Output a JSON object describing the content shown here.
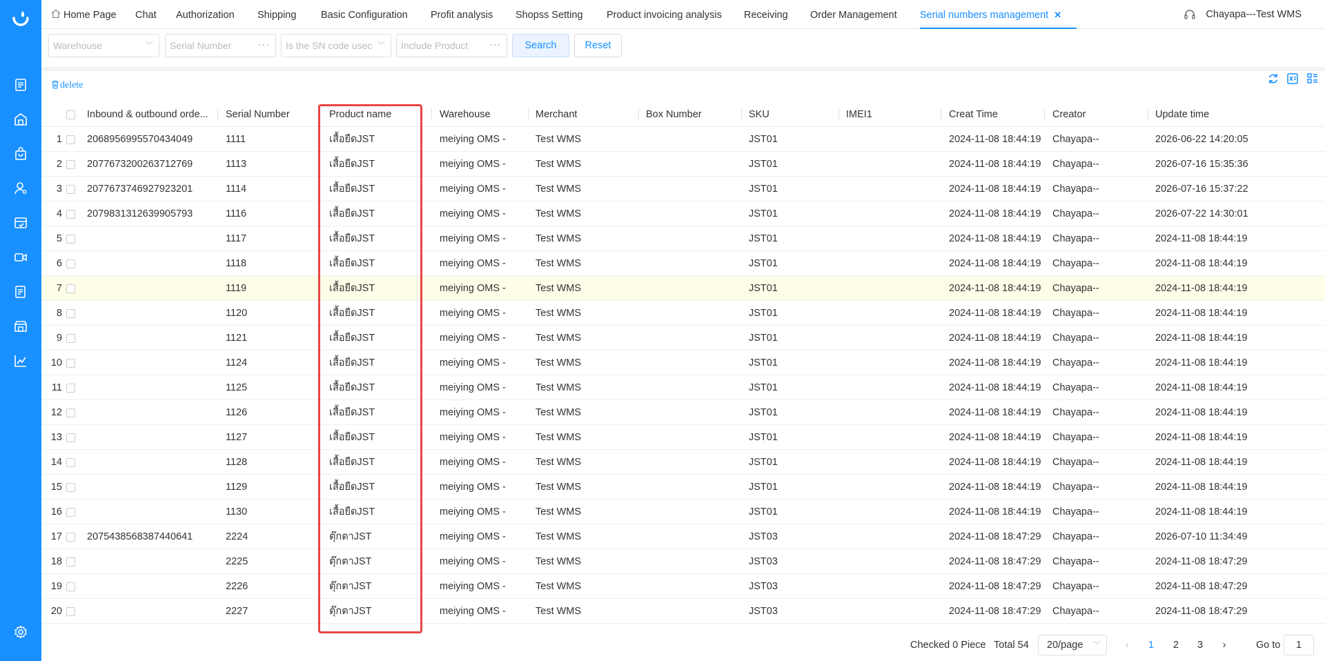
{
  "tabs": [
    {
      "label": "Home Page",
      "home": true
    },
    {
      "label": "Chat"
    },
    {
      "label": "Authorization"
    },
    {
      "label": "Shipping"
    },
    {
      "label": "Basic Configuration"
    },
    {
      "label": "Profit analysis"
    },
    {
      "label": "Shopss Setting"
    },
    {
      "label": "Product invoicing analysis"
    },
    {
      "label": "Receiving"
    },
    {
      "label": "Order Management"
    },
    {
      "label": "Serial numbers management",
      "active": true
    }
  ],
  "user": "Chayapa---Test WMS",
  "filters": {
    "warehouse_placeholder": "Warehouse",
    "serial_placeholder": "Serial Number",
    "sn_used_placeholder": "Is the SN code usec",
    "include_product_placeholder": "Include Product",
    "search_label": "Search",
    "reset_label": "Reset"
  },
  "toolbar": {
    "delete_label": "delete"
  },
  "table": {
    "columns": [
      "Inbound & outbound orde...",
      "Serial Number",
      "Product name",
      "Warehouse",
      "Merchant",
      "Box Number",
      "SKU",
      "IMEI1",
      "Creat Time",
      "Creator",
      "Update time"
    ],
    "rows": [
      {
        "idx": "1",
        "order": "2068956995570434049",
        "serial": "1111",
        "product": "เสื้อยืดJST",
        "warehouse": "meiying OMS -",
        "merchant": "Test WMS",
        "box": "",
        "sku": "JST01",
        "imei": "",
        "created": "2024-11-08 18:44:19",
        "creator": "Chayapa--",
        "updated": "2026-06-22 14:20:05"
      },
      {
        "idx": "2",
        "order": "2077673200263712769",
        "serial": "1113",
        "product": "เสื้อยืดJST",
        "warehouse": "meiying OMS -",
        "merchant": "Test WMS",
        "box": "",
        "sku": "JST01",
        "imei": "",
        "created": "2024-11-08 18:44:19",
        "creator": "Chayapa--",
        "updated": "2026-07-16 15:35:36"
      },
      {
        "idx": "3",
        "order": "2077673746927923201",
        "serial": "1114",
        "product": "เสื้อยืดJST",
        "warehouse": "meiying OMS -",
        "merchant": "Test WMS",
        "box": "",
        "sku": "JST01",
        "imei": "",
        "created": "2024-11-08 18:44:19",
        "creator": "Chayapa--",
        "updated": "2026-07-16 15:37:22"
      },
      {
        "idx": "4",
        "order": "2079831312639905793",
        "serial": "1116",
        "product": "เสื้อยืดJST",
        "warehouse": "meiying OMS -",
        "merchant": "Test WMS",
        "box": "",
        "sku": "JST01",
        "imei": "",
        "created": "2024-11-08 18:44:19",
        "creator": "Chayapa--",
        "updated": "2026-07-22 14:30:01"
      },
      {
        "idx": "5",
        "order": "",
        "serial": "1117",
        "product": "เสื้อยืดJST",
        "warehouse": "meiying OMS -",
        "merchant": "Test WMS",
        "box": "",
        "sku": "JST01",
        "imei": "",
        "created": "2024-11-08 18:44:19",
        "creator": "Chayapa--",
        "updated": "2024-11-08 18:44:19"
      },
      {
        "idx": "6",
        "order": "",
        "serial": "1118",
        "product": "เสื้อยืดJST",
        "warehouse": "meiying OMS -",
        "merchant": "Test WMS",
        "box": "",
        "sku": "JST01",
        "imei": "",
        "created": "2024-11-08 18:44:19",
        "creator": "Chayapa--",
        "updated": "2024-11-08 18:44:19"
      },
      {
        "idx": "7",
        "order": "",
        "serial": "1119",
        "product": "เสื้อยืดJST",
        "warehouse": "meiying OMS -",
        "merchant": "Test WMS",
        "box": "",
        "sku": "JST01",
        "imei": "",
        "created": "2024-11-08 18:44:19",
        "creator": "Chayapa--",
        "updated": "2024-11-08 18:44:19",
        "highlight": true
      },
      {
        "idx": "8",
        "order": "",
        "serial": "1120",
        "product": "เสื้อยืดJST",
        "warehouse": "meiying OMS -",
        "merchant": "Test WMS",
        "box": "",
        "sku": "JST01",
        "imei": "",
        "created": "2024-11-08 18:44:19",
        "creator": "Chayapa--",
        "updated": "2024-11-08 18:44:19"
      },
      {
        "idx": "9",
        "order": "",
        "serial": "1121",
        "product": "เสื้อยืดJST",
        "warehouse": "meiying OMS -",
        "merchant": "Test WMS",
        "box": "",
        "sku": "JST01",
        "imei": "",
        "created": "2024-11-08 18:44:19",
        "creator": "Chayapa--",
        "updated": "2024-11-08 18:44:19"
      },
      {
        "idx": "10",
        "order": "",
        "serial": "1124",
        "product": "เสื้อยืดJST",
        "warehouse": "meiying OMS -",
        "merchant": "Test WMS",
        "box": "",
        "sku": "JST01",
        "imei": "",
        "created": "2024-11-08 18:44:19",
        "creator": "Chayapa--",
        "updated": "2024-11-08 18:44:19"
      },
      {
        "idx": "11",
        "order": "",
        "serial": "1125",
        "product": "เสื้อยืดJST",
        "warehouse": "meiying OMS -",
        "merchant": "Test WMS",
        "box": "",
        "sku": "JST01",
        "imei": "",
        "created": "2024-11-08 18:44:19",
        "creator": "Chayapa--",
        "updated": "2024-11-08 18:44:19"
      },
      {
        "idx": "12",
        "order": "",
        "serial": "1126",
        "product": "เสื้อยืดJST",
        "warehouse": "meiying OMS -",
        "merchant": "Test WMS",
        "box": "",
        "sku": "JST01",
        "imei": "",
        "created": "2024-11-08 18:44:19",
        "creator": "Chayapa--",
        "updated": "2024-11-08 18:44:19"
      },
      {
        "idx": "13",
        "order": "",
        "serial": "1127",
        "product": "เสื้อยืดJST",
        "warehouse": "meiying OMS -",
        "merchant": "Test WMS",
        "box": "",
        "sku": "JST01",
        "imei": "",
        "created": "2024-11-08 18:44:19",
        "creator": "Chayapa--",
        "updated": "2024-11-08 18:44:19"
      },
      {
        "idx": "14",
        "order": "",
        "serial": "1128",
        "product": "เสื้อยืดJST",
        "warehouse": "meiying OMS -",
        "merchant": "Test WMS",
        "box": "",
        "sku": "JST01",
        "imei": "",
        "created": "2024-11-08 18:44:19",
        "creator": "Chayapa--",
        "updated": "2024-11-08 18:44:19"
      },
      {
        "idx": "15",
        "order": "",
        "serial": "1129",
        "product": "เสื้อยืดJST",
        "warehouse": "meiying OMS -",
        "merchant": "Test WMS",
        "box": "",
        "sku": "JST01",
        "imei": "",
        "created": "2024-11-08 18:44:19",
        "creator": "Chayapa--",
        "updated": "2024-11-08 18:44:19"
      },
      {
        "idx": "16",
        "order": "",
        "serial": "1130",
        "product": "เสื้อยืดJST",
        "warehouse": "meiying OMS -",
        "merchant": "Test WMS",
        "box": "",
        "sku": "JST01",
        "imei": "",
        "created": "2024-11-08 18:44:19",
        "creator": "Chayapa--",
        "updated": "2024-11-08 18:44:19"
      },
      {
        "idx": "17",
        "order": "2075438568387440641",
        "serial": "2224",
        "product": "ตุ๊กตาJST",
        "warehouse": "meiying OMS -",
        "merchant": "Test WMS",
        "box": "",
        "sku": "JST03",
        "imei": "",
        "created": "2024-11-08 18:47:29",
        "creator": "Chayapa--",
        "updated": "2026-07-10 11:34:49"
      },
      {
        "idx": "18",
        "order": "",
        "serial": "2225",
        "product": "ตุ๊กตาJST",
        "warehouse": "meiying OMS -",
        "merchant": "Test WMS",
        "box": "",
        "sku": "JST03",
        "imei": "",
        "created": "2024-11-08 18:47:29",
        "creator": "Chayapa--",
        "updated": "2024-11-08 18:47:29"
      },
      {
        "idx": "19",
        "order": "",
        "serial": "2226",
        "product": "ตุ๊กตาJST",
        "warehouse": "meiying OMS -",
        "merchant": "Test WMS",
        "box": "",
        "sku": "JST03",
        "imei": "",
        "created": "2024-11-08 18:47:29",
        "creator": "Chayapa--",
        "updated": "2024-11-08 18:47:29"
      },
      {
        "idx": "20",
        "order": "",
        "serial": "2227",
        "product": "ตุ๊กตาJST",
        "warehouse": "meiying OMS -",
        "merchant": "Test WMS",
        "box": "",
        "sku": "JST03",
        "imei": "",
        "created": "2024-11-08 18:47:29",
        "creator": "Chayapa--",
        "updated": "2024-11-08 18:47:29"
      }
    ]
  },
  "footer": {
    "checked": "Checked 0 Piece",
    "total": "Total 54",
    "page_size": "20/page",
    "pages": [
      "1",
      "2",
      "3"
    ],
    "current_page": "1",
    "goto_label": "Go to",
    "goto_value": "1"
  },
  "colors": {
    "accent": "#1890ff",
    "highlight_box": "#e84545",
    "row_highlight": "#fdfde8"
  }
}
